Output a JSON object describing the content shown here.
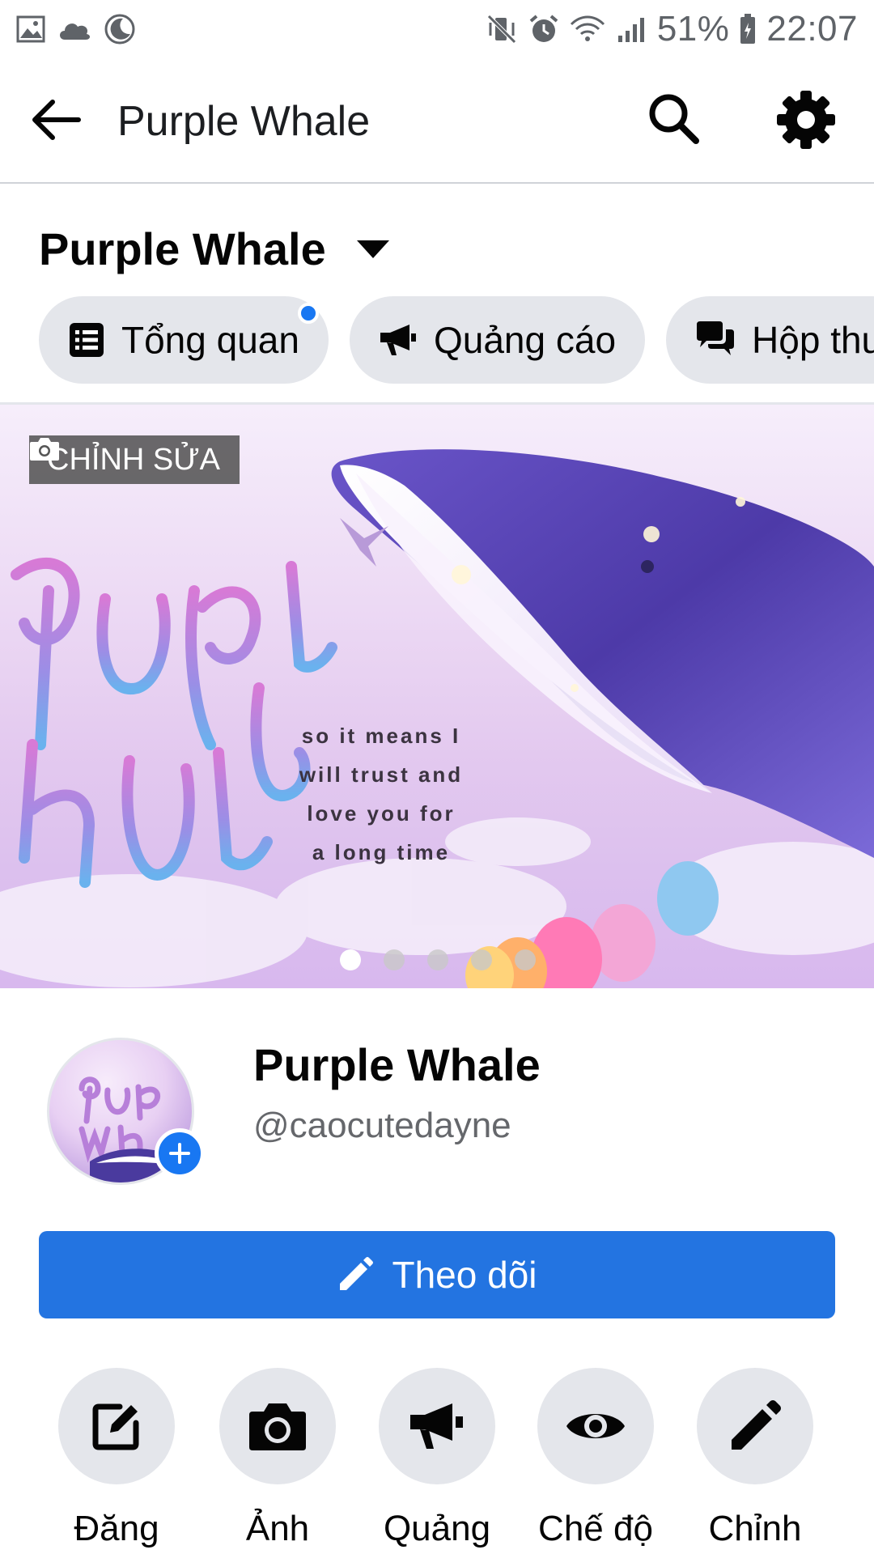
{
  "status_bar": {
    "battery": "51%",
    "time": "22:07",
    "left_icons": [
      "image-icon",
      "cloud-icon",
      "moon-icon"
    ],
    "right_icons": [
      "mute-icon",
      "alarm-icon",
      "wifi-icon",
      "signal-icon",
      "battery-icon"
    ]
  },
  "app_bar": {
    "title": "Purple Whale"
  },
  "page_switcher": {
    "name": "Purple Whale"
  },
  "tabs": [
    {
      "label": "Tổng quan",
      "icon": "list-icon",
      "has_dot": true
    },
    {
      "label": "Quảng cáo",
      "icon": "megaphone-icon",
      "has_dot": false
    },
    {
      "label": "Hộp thư",
      "icon": "chat-icon",
      "has_dot": true
    }
  ],
  "cover": {
    "edit_label": "CHỈNH SỬA",
    "quote": [
      "so it means I",
      "will trust and",
      "love you for",
      "a long time"
    ],
    "carousel_count": 5,
    "carousel_active": 0
  },
  "profile": {
    "name": "Purple Whale",
    "handle": "@caocutedayne"
  },
  "follow_button": {
    "label": "Theo dõi"
  },
  "actions": [
    {
      "label": "Đăng",
      "icon": "edit-square-icon"
    },
    {
      "label": "Ảnh",
      "icon": "camera-icon"
    },
    {
      "label": "Quảng",
      "icon": "megaphone-icon"
    },
    {
      "label": "Chế độ",
      "icon": "eye-icon"
    },
    {
      "label": "Chỉnh",
      "icon": "pencil-icon"
    }
  ],
  "colors": {
    "accent": "#1877f2",
    "button_blue": "#2374e1",
    "chip_bg": "#e4e6eb",
    "muted_text": "#65676b"
  }
}
